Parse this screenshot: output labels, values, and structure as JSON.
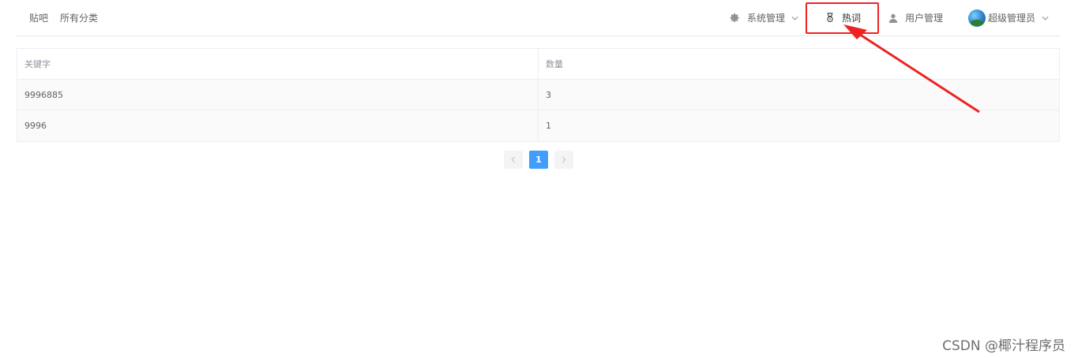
{
  "nav": {
    "left": [
      {
        "label": "贴吧"
      },
      {
        "label": "所有分类"
      }
    ],
    "system": {
      "label": "系统管理",
      "icon": "gear-icon"
    },
    "hot": {
      "label": "热词",
      "icon": "medal-icon"
    },
    "users": {
      "label": "用户管理",
      "icon": "user-icon"
    },
    "account": {
      "label": "超级管理员",
      "icon": "avatar"
    }
  },
  "table": {
    "headers": [
      "关键字",
      "数量"
    ],
    "rows": [
      {
        "keyword": "9996885",
        "count": "3"
      },
      {
        "keyword": "9996",
        "count": "1"
      }
    ]
  },
  "pagination": {
    "prev": "<",
    "current": "1",
    "next": ">"
  },
  "annotation": {
    "color": "#ee2222"
  },
  "colors": {
    "accent": "#409eff",
    "highlight": "#ee2222"
  },
  "watermark": "CSDN @椰汁程序员"
}
